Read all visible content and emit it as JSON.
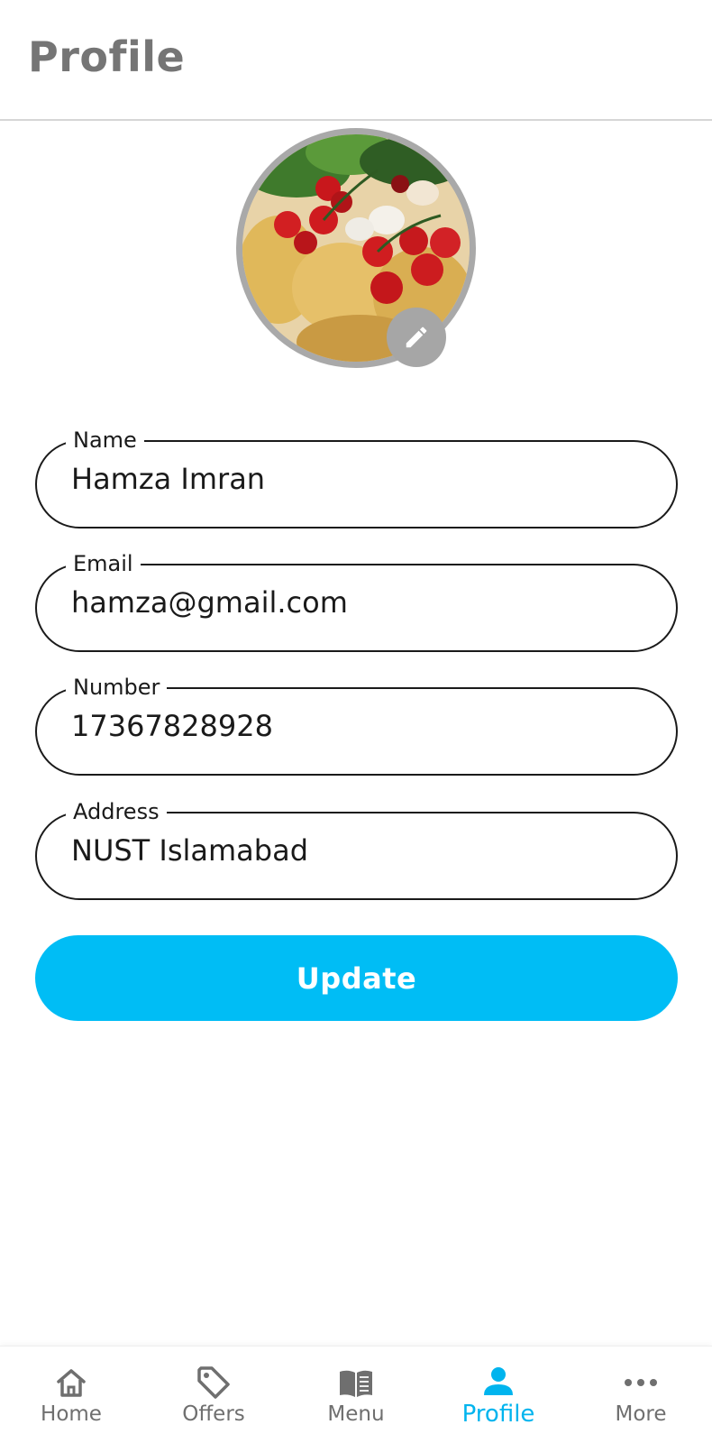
{
  "header": {
    "title": "Profile"
  },
  "form": {
    "fields": [
      {
        "label": "Name",
        "value": "Hamza Imran"
      },
      {
        "label": "Email",
        "value": "hamza@gmail.com"
      },
      {
        "label": "Number",
        "value": "17367828928"
      },
      {
        "label": "Address",
        "value": "NUST Islamabad"
      }
    ],
    "submit_label": "Update"
  },
  "nav": {
    "items": [
      {
        "label": "Home",
        "icon": "home-icon"
      },
      {
        "label": "Offers",
        "icon": "tag-icon"
      },
      {
        "label": "Menu",
        "icon": "book-icon"
      },
      {
        "label": "Profile",
        "icon": "person-icon",
        "active": true
      },
      {
        "label": "More",
        "icon": "more-dots-icon"
      }
    ]
  },
  "colors": {
    "accent": "#00bdf5",
    "title": "#757575",
    "edit_badge": "#a6a6a6"
  }
}
